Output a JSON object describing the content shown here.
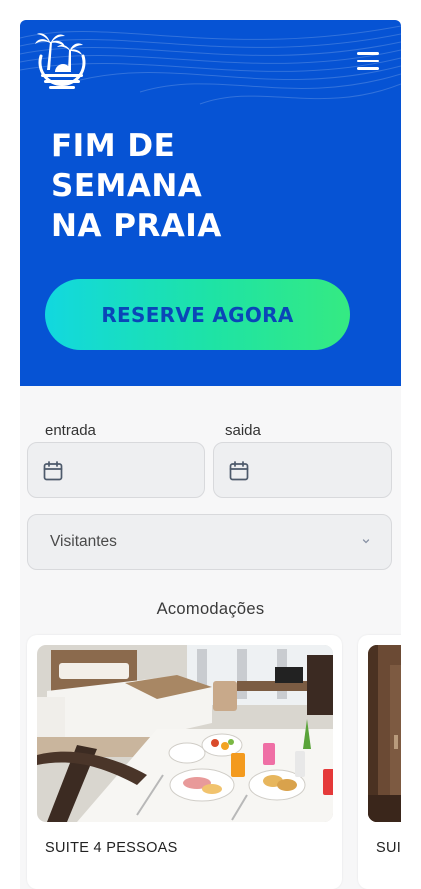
{
  "hero": {
    "title_lines": [
      "FIM DE",
      "SEMANA",
      "NA PRAIA"
    ],
    "cta_label": "RESERVE AGORA",
    "background_color": "#0653d4",
    "cta_gradient": [
      "#12d8df",
      "#35ea82"
    ]
  },
  "header": {
    "logo_icon": "palm-beach-logo-icon",
    "menu_icon": "hamburger-menu-icon"
  },
  "booking": {
    "checkin_label": "entrada",
    "checkout_label": "saida",
    "visitors_label": "Visitantes"
  },
  "accommodations": {
    "title": "Acomodações",
    "items": [
      {
        "name": "SUITE 4 PESSOAS"
      },
      {
        "name": "SUI"
      }
    ]
  }
}
